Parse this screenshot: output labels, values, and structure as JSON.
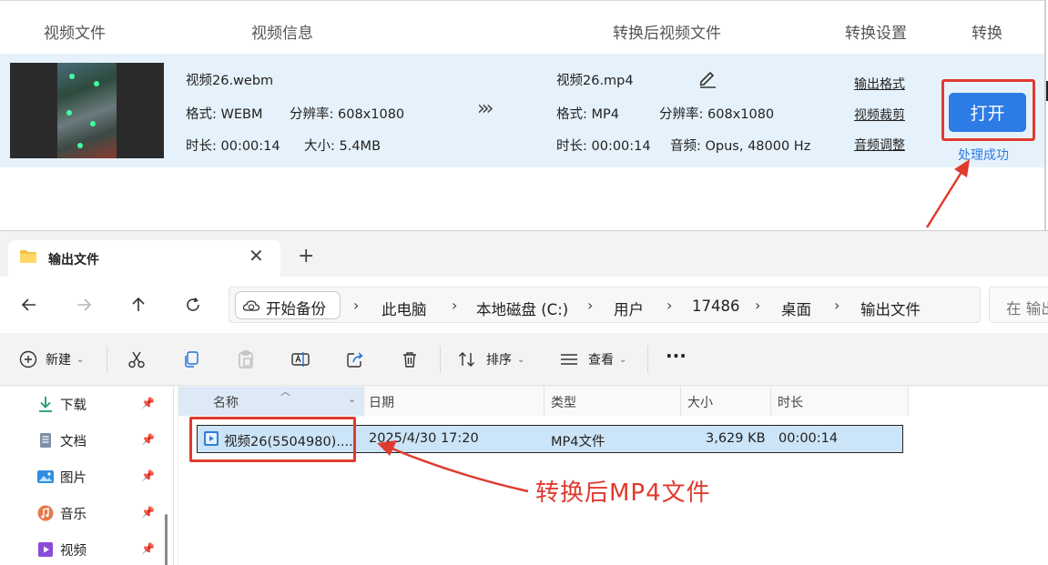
{
  "converter": {
    "headers": {
      "video_file": "视频文件",
      "video_info": "视频信息",
      "converted_file": "转换后视频文件",
      "convert_settings": "转换设置",
      "convert": "转换"
    },
    "source": {
      "filename": "视频26.webm",
      "format": "格式: WEBM",
      "resolution": "分辨率: 608x1080",
      "duration": "时长: 00:00:14",
      "size": "大小: 5.4MB"
    },
    "arrow": "›››",
    "output": {
      "filename": "视频26.mp4",
      "format": "格式: MP4",
      "resolution": "分辨率: 608x1080",
      "duration": "时长: 00:00:14",
      "audio": "音频: Opus, 48000 Hz"
    },
    "settings": {
      "output_format": "输出格式",
      "video_crop": "视频裁剪",
      "audio_adjust": "音频调整"
    },
    "open_button": "打开",
    "status": "处理成功"
  },
  "explorer": {
    "tab_title": "输出文件",
    "tab_close": "✕",
    "tab_new": "+",
    "backup_label": "开始备份",
    "breadcrumbs": [
      "此电脑",
      "本地磁盘 (C:)",
      "用户",
      "17486",
      "桌面",
      "输出文件"
    ],
    "search_placeholder": "在 输出",
    "toolbar": {
      "new": "新建",
      "sort": "排序",
      "view": "查看",
      "more": "···"
    },
    "sidebar": [
      {
        "label": "下载",
        "icon": "download-icon"
      },
      {
        "label": "文档",
        "icon": "document-icon"
      },
      {
        "label": "图片",
        "icon": "picture-icon"
      },
      {
        "label": "音乐",
        "icon": "music-icon"
      },
      {
        "label": "视频",
        "icon": "video-icon"
      }
    ],
    "columns": {
      "name": "名称",
      "date": "日期",
      "type": "类型",
      "size": "大小",
      "duration": "时长"
    },
    "file": {
      "name": "视频26(5504980)....",
      "date": "2025/4/30 17:20",
      "type": "MP4文件",
      "size": "3,629 KB",
      "duration": "00:00:14"
    }
  },
  "annotation": {
    "label": "转换后MP4文件",
    "color": "#e03a2f"
  },
  "colors": {
    "accent": "#2d7be5",
    "row_highlight": "#e6f2fb",
    "selection": "#cce4f7"
  }
}
